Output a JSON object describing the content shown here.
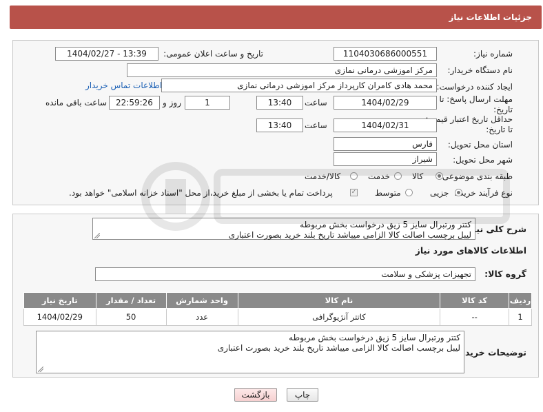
{
  "header": {
    "title": "جزئیات اطلاعات نیاز"
  },
  "form": {
    "need_number": {
      "label": "شماره نیاز:",
      "value": "1104030686000551"
    },
    "announce_datetime": {
      "label": "تاریخ و ساعت اعلان عمومی:",
      "value": "1404/02/27 - 13:39"
    },
    "buyer_org": {
      "label": "نام دستگاه خریدار:",
      "value": "مرکز اموزشی درمانی نمازی"
    },
    "requester": {
      "label": "ایجاد کننده درخواست:",
      "value": "محمد هادی کامران کارپرداز مرکز اموزشی درمانی نمازی",
      "contact_link": "اطلاعات تماس خریدار"
    },
    "reply_deadline": {
      "label_line1": "مهلت ارسال پاسخ: تا",
      "label_line2": "تاریخ:",
      "date": "1404/02/29",
      "time_label": "ساعت",
      "time": "13:40",
      "days_value": "1",
      "days_label": "روز و",
      "remaining_time": "22:59:26",
      "remaining_label": "ساعت باقی مانده"
    },
    "price_validity": {
      "label_line1": "حداقل تاریخ اعتبار قیمت:",
      "label_line2": "تا تاریخ:",
      "date": "1404/02/31",
      "time_label": "ساعت",
      "time": "13:40"
    },
    "delivery_province": {
      "label": "استان محل تحویل:",
      "value": "فارس"
    },
    "delivery_city": {
      "label": "شهر محل تحویل:",
      "value": "شیراز"
    },
    "category": {
      "label": "طبقه بندی موضوعی:",
      "options": [
        "کالا",
        "خدمت",
        "کالا/خدمت"
      ],
      "selected": "کالا"
    },
    "purchase_process": {
      "label": "نوع فرآیند خرید :",
      "options": [
        "جزیی",
        "متوسط"
      ],
      "selected": "جزیی",
      "payment_note": "پرداخت تمام یا بخشی از مبلغ خرید،از محل \"اسناد خزانه اسلامی\" خواهد بود."
    }
  },
  "summary": {
    "label": "شرح کلی نیاز:",
    "lines": [
      "کتتر ورتبرال سایز 5 زیق درخواست بخش مربوطه",
      "لیبل برچسب اصالت کالا الزامی میباشد تاریخ بلند خرید بصورت اعتباری"
    ]
  },
  "items_section": {
    "title": "اطلاعات کالاهای مورد نیاز"
  },
  "goods_group": {
    "label": "گروه کالا:",
    "value": "تجهیزات پزشکی و سلامت"
  },
  "table": {
    "columns": [
      "ردیف",
      "کد کالا",
      "نام کالا",
      "واحد شمارش",
      "تعداد / مقدار",
      "تاریخ نیاز"
    ],
    "rows": [
      [
        "1",
        "--",
        "کاتتر آنژیوگرافی",
        "عدد",
        "50",
        "1404/02/29"
      ]
    ]
  },
  "buyer_notes": {
    "label": "توضیحات خریدار:",
    "lines": [
      "کتتر ورتبرال سایز 5 زیق درخواست بخش مربوطه",
      "لیبل برچسب اصالت کالا الزامی میباشد تاریخ بلند خرید بصورت اعتباری"
    ]
  },
  "buttons": {
    "print": "چاپ",
    "back": "بازگشت"
  },
  "colors": {
    "header": "#b8524a",
    "table_header": "#8a8a8a",
    "link": "#1a5fb4"
  }
}
